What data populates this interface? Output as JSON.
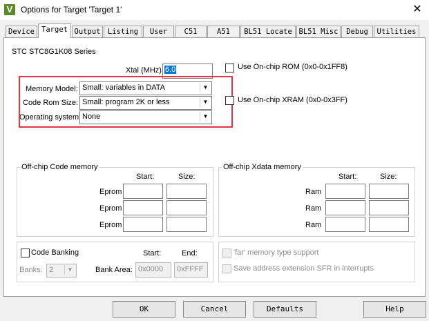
{
  "window": {
    "title": "Options for Target 'Target 1'",
    "close_glyph": "✕",
    "app_icon": "keil-icon"
  },
  "tabs": [
    {
      "label": "Device"
    },
    {
      "label": "Target"
    },
    {
      "label": "Output"
    },
    {
      "label": "Listing"
    },
    {
      "label": "User"
    },
    {
      "label": "C51"
    },
    {
      "label": "A51"
    },
    {
      "label": "BL51 Locate"
    },
    {
      "label": "BL51 Misc"
    },
    {
      "label": "Debug"
    },
    {
      "label": "Utilities"
    }
  ],
  "device": {
    "name": "STC STC8G1K08 Series"
  },
  "xtal": {
    "label": "Xtal (MHz):",
    "value": "6.0"
  },
  "memory_model": {
    "label": "Memory Model:",
    "value": "Small: variables in DATA"
  },
  "code_rom_size": {
    "label": "Code Rom Size:",
    "value": "Small: program 2K or less"
  },
  "operating_system": {
    "label": "Operating system:",
    "value": "None"
  },
  "on_chip_rom": {
    "label": "Use On-chip ROM (0x0-0x1FF8)"
  },
  "on_chip_xram": {
    "label": "Use On-chip XRAM (0x0-0x3FF)"
  },
  "code_memory": {
    "title": "Off-chip Code memory",
    "start_header": "Start:",
    "size_header": "Size:",
    "rows": [
      {
        "label": "Eprom"
      },
      {
        "label": "Eprom"
      },
      {
        "label": "Eprom"
      }
    ]
  },
  "xdata_memory": {
    "title": "Off-chip Xdata memory",
    "start_header": "Start:",
    "size_header": "Size:",
    "rows": [
      {
        "label": "Ram"
      },
      {
        "label": "Ram"
      },
      {
        "label": "Ram"
      }
    ]
  },
  "code_banking": {
    "label": "Code Banking",
    "start_header": "Start:",
    "end_header": "End:",
    "banks_label": "Banks:",
    "banks_value": "2",
    "bank_area_label": "Bank Area:",
    "bank_area_start": "0x0000",
    "bank_area_end": "0xFFFF"
  },
  "far_memory": {
    "label": "'far' memory type support"
  },
  "sfr_ext": {
    "label": "Save address extension SFR in interrupts"
  },
  "buttons": {
    "ok": "OK",
    "cancel": "Cancel",
    "defaults": "Defaults",
    "help": "Help"
  },
  "colors": {
    "highlight_box": "#e8343c",
    "selection": "#0078d7"
  }
}
